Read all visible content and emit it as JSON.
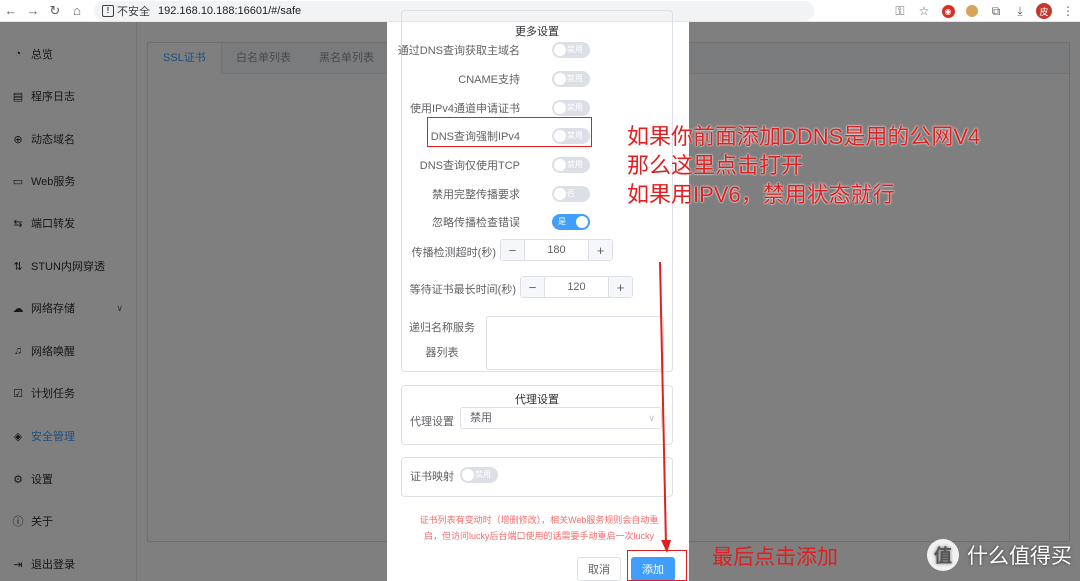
{
  "browser": {
    "security_label": "不安全",
    "url": "192.168.10.188:16601/#/safe",
    "avatar_letter": "皮"
  },
  "sidebar": {
    "items": [
      {
        "label": "总览",
        "icon": "dashboard-icon"
      },
      {
        "label": "程序日志",
        "icon": "log-icon"
      },
      {
        "label": "动态域名",
        "icon": "globe-icon"
      },
      {
        "label": "Web服务",
        "icon": "web-icon"
      },
      {
        "label": "端口转发",
        "icon": "forward-icon"
      },
      {
        "label": "STUN内网穿透",
        "icon": "stun-icon"
      },
      {
        "label": "网络存储",
        "icon": "storage-icon"
      },
      {
        "label": "网络唤醒",
        "icon": "bell-icon"
      },
      {
        "label": "计划任务",
        "icon": "task-icon"
      },
      {
        "label": "安全管理",
        "icon": "shield-icon"
      },
      {
        "label": "设置",
        "icon": "gear-icon"
      },
      {
        "label": "关于",
        "icon": "about-icon"
      },
      {
        "label": "退出登录",
        "icon": "logout-icon"
      }
    ],
    "active_index": 9
  },
  "main": {
    "tabs": [
      {
        "label": "SSL证书"
      },
      {
        "label": "白名单列表"
      },
      {
        "label": "黑名单列表"
      }
    ]
  },
  "dialog": {
    "more_settings_title": "更多设置",
    "switch_rows": [
      {
        "label": "通过DNS查询获取主域名",
        "state": "禁用",
        "on": false
      },
      {
        "label": "CNAME支持",
        "state": "禁用",
        "on": false
      },
      {
        "label": "使用IPv4通道申请证书",
        "state": "禁用",
        "on": false
      },
      {
        "label": "DNS查询强制IPv4",
        "state": "禁用",
        "on": false
      },
      {
        "label": "DNS查询仅使用TCP",
        "state": "禁用",
        "on": false
      },
      {
        "label": "禁用完整传播要求",
        "state": "否",
        "on": false
      },
      {
        "label": "忽略传播检查错误",
        "state": "是",
        "on": true
      }
    ],
    "propagation_timeout": {
      "label": "传播检测超时(秒)",
      "value": "180"
    },
    "cert_wait": {
      "label": "等待证书最长时间(秒)",
      "value": "120"
    },
    "resolvers": {
      "label_line1": "递归名称服务",
      "label_line2": "器列表",
      "value": ""
    },
    "proxy": {
      "title": "代理设置",
      "label": "代理设置",
      "value": "禁用"
    },
    "cert_mapping": {
      "label": "证书映射",
      "state": "禁用",
      "on": false
    },
    "notice_line1": "证书列表有变动时（增删修改），相关Web服务规则会自动重",
    "notice_line2": "启，但访问lucky后台端口使用的话需要手动重启一次lucky",
    "cancel_label": "取消",
    "add_label": "添加"
  },
  "annotations": {
    "line1": "如果你前面添加DDNS是用的公网V4",
    "line2": "那么这里点击打开",
    "line3": "如果用IPV6，禁用状态就行",
    "bottom": "最后点击添加"
  },
  "watermark": {
    "logo_text": "值",
    "text": "什么值得买"
  }
}
